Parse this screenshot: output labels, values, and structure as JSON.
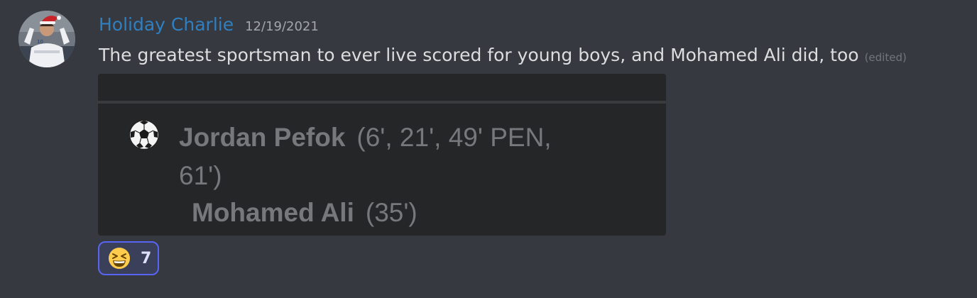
{
  "message": {
    "username": "Holiday Charlie",
    "timestamp": "12/19/2021",
    "text": "The greatest sportsman to ever live scored for young boys, and Mohamed Ali did, too",
    "edited_label": "(edited)",
    "username_color": "#2f7fc1"
  },
  "attachment": {
    "icon": "soccer-ball-icon",
    "scorers": [
      {
        "name": "Jordan Pefok",
        "minutes_line1": "(6', 21', 49' PEN,",
        "minutes_line2": "61')"
      },
      {
        "name": "Mohamed Ali",
        "minutes_line1": "(35')"
      }
    ]
  },
  "reactions": [
    {
      "emoji": "grinning-squinting-face-icon",
      "count": "7",
      "active": true
    }
  ],
  "colors": {
    "background": "#36393f",
    "reaction_border": "#5865f2"
  }
}
